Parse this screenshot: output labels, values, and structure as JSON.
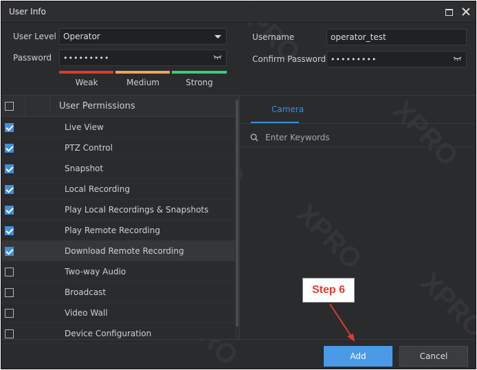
{
  "window": {
    "title": "User Info"
  },
  "form": {
    "user_level_label": "User Level",
    "user_level_value": "Operator",
    "password_label": "Password",
    "password_value": "•••••••••",
    "username_label": "Username",
    "username_value": "operator_test",
    "confirm_password_label": "Confirm Password",
    "confirm_password_value": "•••••••••"
  },
  "strength": {
    "weak": "Weak",
    "medium": "Medium",
    "strong": "Strong",
    "colors": {
      "weak": "#e23a2e",
      "medium": "#f0a55a",
      "strong": "#3ecb7a"
    }
  },
  "permissions": {
    "header": "User Permissions",
    "items": [
      {
        "label": "Live View",
        "checked": true
      },
      {
        "label": "PTZ Control",
        "checked": true
      },
      {
        "label": "Snapshot",
        "checked": true
      },
      {
        "label": "Local Recording",
        "checked": true
      },
      {
        "label": "Play Local Recordings & Snapshots",
        "checked": true
      },
      {
        "label": "Play Remote Recording",
        "checked": true
      },
      {
        "label": "Download Remote Recording",
        "checked": true
      },
      {
        "label": "Two-way Audio",
        "checked": false
      },
      {
        "label": "Broadcast",
        "checked": false
      },
      {
        "label": "Video Wall",
        "checked": false
      },
      {
        "label": "Device Configuration",
        "checked": false
      }
    ]
  },
  "camera_panel": {
    "tab": "Camera",
    "search_placeholder": "Enter Keywords"
  },
  "buttons": {
    "add": "Add",
    "cancel": "Cancel"
  },
  "annotation": {
    "step": "Step 6"
  },
  "watermark": "XPRO",
  "colors": {
    "accent": "#4a9ae8",
    "annotation": "#e23a2e"
  }
}
